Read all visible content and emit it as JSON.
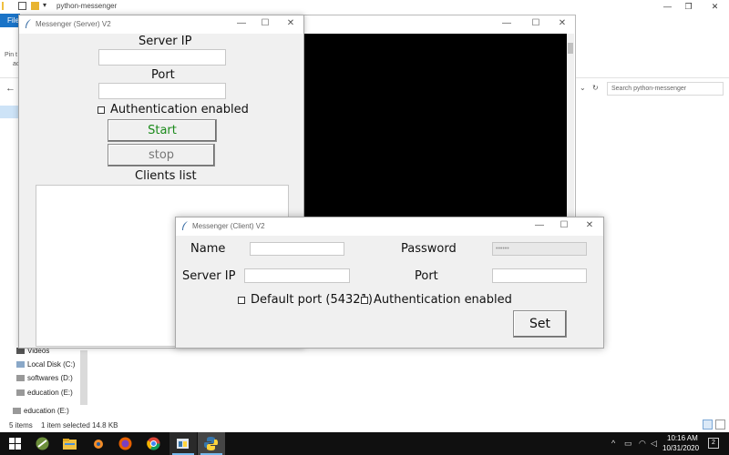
{
  "explorer": {
    "title": "python-messenger",
    "file_tab": "File",
    "pin_text_1": "Pin t",
    "pin_text_2": "ac",
    "search_placeholder": "Search python-messenger",
    "nav_items": [
      "Videos",
      "Local Disk (C:)",
      "softwares (D:)",
      "education (E:)",
      "education (E:)"
    ],
    "status_items": "5 items",
    "status_selected": "1 item selected  14.8 KB",
    "minimize": "—",
    "maximize": "❐",
    "close": "✕"
  },
  "server_window": {
    "title": "Messenger (Server) V2",
    "server_ip_label": "Server IP",
    "server_ip_value": "",
    "port_label": "Port",
    "port_value": "",
    "auth_label": "Authentication enabled",
    "start_label": "Start",
    "stop_label": "stop",
    "clients_label": "Clients list",
    "start_color": "#1a8a1a",
    "stop_color": "#777777"
  },
  "client_window": {
    "title": "Messenger (Client) V2",
    "name_label": "Name",
    "name_value": "",
    "password_label": "Password",
    "password_value": "••••••",
    "server_ip_label": "Server IP",
    "server_ip_value": "",
    "port_label": "Port",
    "port_value": "",
    "default_port_label": "Default port (54321)",
    "auth_label": "Authentication enabled",
    "set_label": "Set"
  },
  "window_controls": {
    "minimize": "—",
    "maximize": "☐",
    "close": "✕"
  },
  "taskbar": {
    "time": "10:16 AM",
    "date": "10/31/2020",
    "notifications": "2",
    "icons": [
      "start-icon",
      "pycharm-icon",
      "file-explorer-icon",
      "blender-icon",
      "firefox-icon",
      "chrome-icon",
      "python-idle-icon",
      "python-icon"
    ]
  }
}
